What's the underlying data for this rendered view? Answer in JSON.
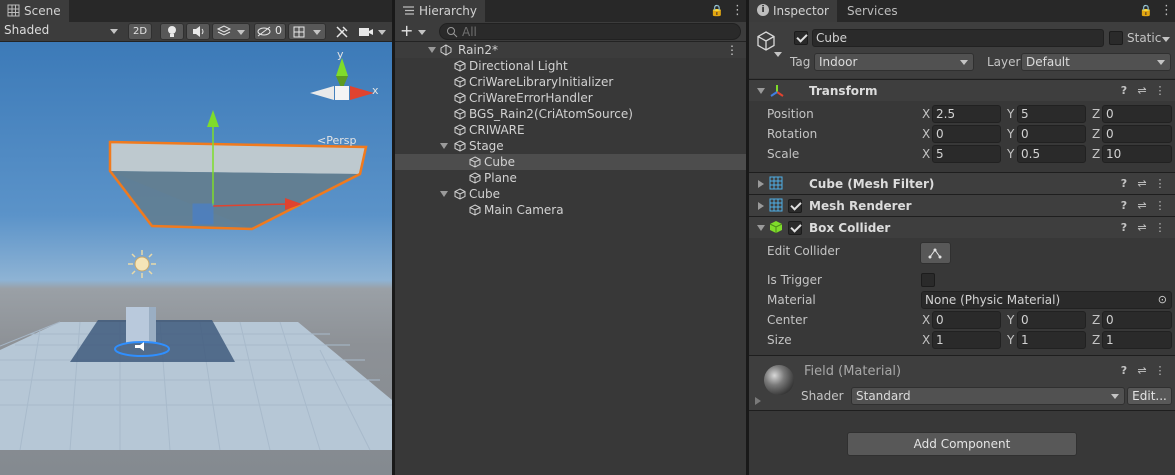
{
  "scene": {
    "tab_label": "Scene",
    "shading_mode": "Shaded",
    "mode_2d": "2D",
    "gizmo_count": "0",
    "persp_label": "Persp",
    "gizmo_axes": {
      "y": "y",
      "x": "x"
    }
  },
  "hierarchy": {
    "tab_label": "Hierarchy",
    "search_placeholder": "All",
    "scene_name": "Rain2*",
    "items": [
      {
        "label": "Directional Light",
        "depth": 1
      },
      {
        "label": "CriWareLibraryInitializer",
        "depth": 1
      },
      {
        "label": "CriWareErrorHandler",
        "depth": 1
      },
      {
        "label": "BGS_Rain2(CriAtomSource)",
        "depth": 1
      },
      {
        "label": "CRIWARE",
        "depth": 1
      },
      {
        "label": "Stage",
        "depth": 1
      },
      {
        "label": "Cube",
        "depth": 2,
        "selected": true
      },
      {
        "label": "Plane",
        "depth": 2
      },
      {
        "label": "Cube",
        "depth": 1
      },
      {
        "label": "Main Camera",
        "depth": 2
      }
    ]
  },
  "inspector": {
    "tab_label": "Inspector",
    "services_tab_label": "Services",
    "object_name": "Cube",
    "static_label": "Static",
    "tag_label": "Tag",
    "tag_value": "Indoor",
    "layer_label": "Layer",
    "layer_value": "Default",
    "transform": {
      "title": "Transform",
      "position_label": "Position",
      "rotation_label": "Rotation",
      "scale_label": "Scale",
      "position": {
        "x": "2.5",
        "y": "5",
        "z": "0"
      },
      "rotation": {
        "x": "0",
        "y": "0",
        "z": "0"
      },
      "scale": {
        "x": "5",
        "y": "0.5",
        "z": "10"
      }
    },
    "mesh_filter": {
      "title": "Cube (Mesh Filter)"
    },
    "mesh_renderer": {
      "title": "Mesh Renderer"
    },
    "box_collider": {
      "title": "Box Collider",
      "edit_collider_label": "Edit Collider",
      "is_trigger_label": "Is Trigger",
      "material_label": "Material",
      "material_value": "None (Physic Material)",
      "center_label": "Center",
      "size_label": "Size",
      "center": {
        "x": "0",
        "y": "0",
        "z": "0"
      },
      "size": {
        "x": "1",
        "y": "1",
        "z": "1"
      }
    },
    "material": {
      "title": "Field (Material)",
      "shader_label": "Shader",
      "shader_value": "Standard",
      "edit_label": "Edit..."
    },
    "add_component_label": "Add Component",
    "axis": {
      "x": "X",
      "y": "Y",
      "z": "Z"
    }
  },
  "colors": {
    "accent_selection": "#4d4d4d",
    "selection_outline": "#f07a1e",
    "gizmo_green": "#7fdc2a",
    "gizmo_red": "#e0432f",
    "gizmo_blue": "#3f7fe0"
  }
}
